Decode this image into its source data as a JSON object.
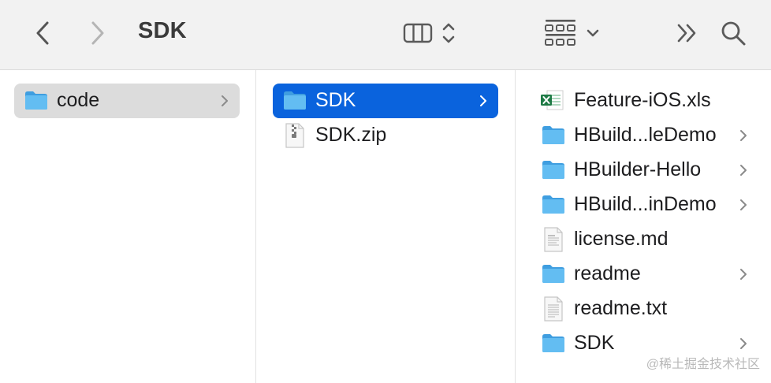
{
  "window": {
    "title": "SDK"
  },
  "toolbar": {
    "back_icon": "chevron-left-icon",
    "forward_icon": "chevron-right-icon",
    "view_icon": "column-view-icon",
    "group_icon": "group-grid-icon",
    "more_icon": "double-chevron-icon",
    "search_icon": "magnifier-icon"
  },
  "columns": [
    {
      "items": [
        {
          "name": "code",
          "type": "folder",
          "has_children": true,
          "selected": "inactive"
        }
      ]
    },
    {
      "items": [
        {
          "name": "SDK",
          "type": "folder",
          "has_children": true,
          "selected": "active"
        },
        {
          "name": "SDK.zip",
          "type": "zip",
          "has_children": false
        }
      ]
    },
    {
      "items": [
        {
          "name": "Feature-iOS.xls",
          "type": "excel",
          "has_children": false
        },
        {
          "name": "HBuild...leDemo",
          "type": "folder",
          "has_children": true
        },
        {
          "name": "HBuilder-Hello",
          "type": "folder",
          "has_children": true
        },
        {
          "name": "HBuild...inDemo",
          "type": "folder",
          "has_children": true
        },
        {
          "name": "license.md",
          "type": "document",
          "has_children": false
        },
        {
          "name": "readme",
          "type": "folder",
          "has_children": true
        },
        {
          "name": "readme.txt",
          "type": "text",
          "has_children": false
        },
        {
          "name": "SDK",
          "type": "folder",
          "has_children": true
        }
      ]
    }
  ],
  "watermark": "@稀土掘金技术社区",
  "colors": {
    "selection_active": "#0a63dd",
    "selection_inactive": "#dcdcdc",
    "folder": "#4fb0ea",
    "toolbar": "#f2f2f2"
  }
}
